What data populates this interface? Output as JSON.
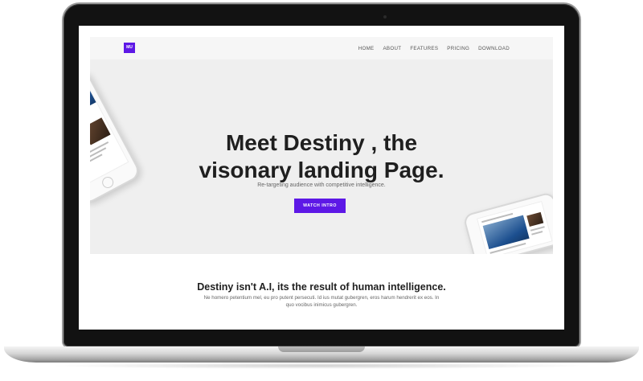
{
  "nav": {
    "logo": "MU",
    "items": [
      "HOME",
      "ABOUT",
      "FEATURES",
      "PRICING",
      "DOWNLOAD"
    ]
  },
  "hero": {
    "title_line1": "Meet Destiny , the",
    "title_line2": "visonary landing Page.",
    "subtitle": "Re-targeting audience with competitive intelligence.",
    "cta": "WATCH INTRO"
  },
  "section": {
    "title": "Destiny isn't A.I, its the result of human intelligence.",
    "body": "Ne homero petentium mel, eu pro putent persecuti. Id ius mutat gubergren, eros harum hendrerit ex eos. In quo vocibus inimicus gubergren."
  },
  "colors": {
    "accent": "#5d18e6",
    "hero_bg": "#efefef",
    "text_dark": "#1f1f1f"
  }
}
